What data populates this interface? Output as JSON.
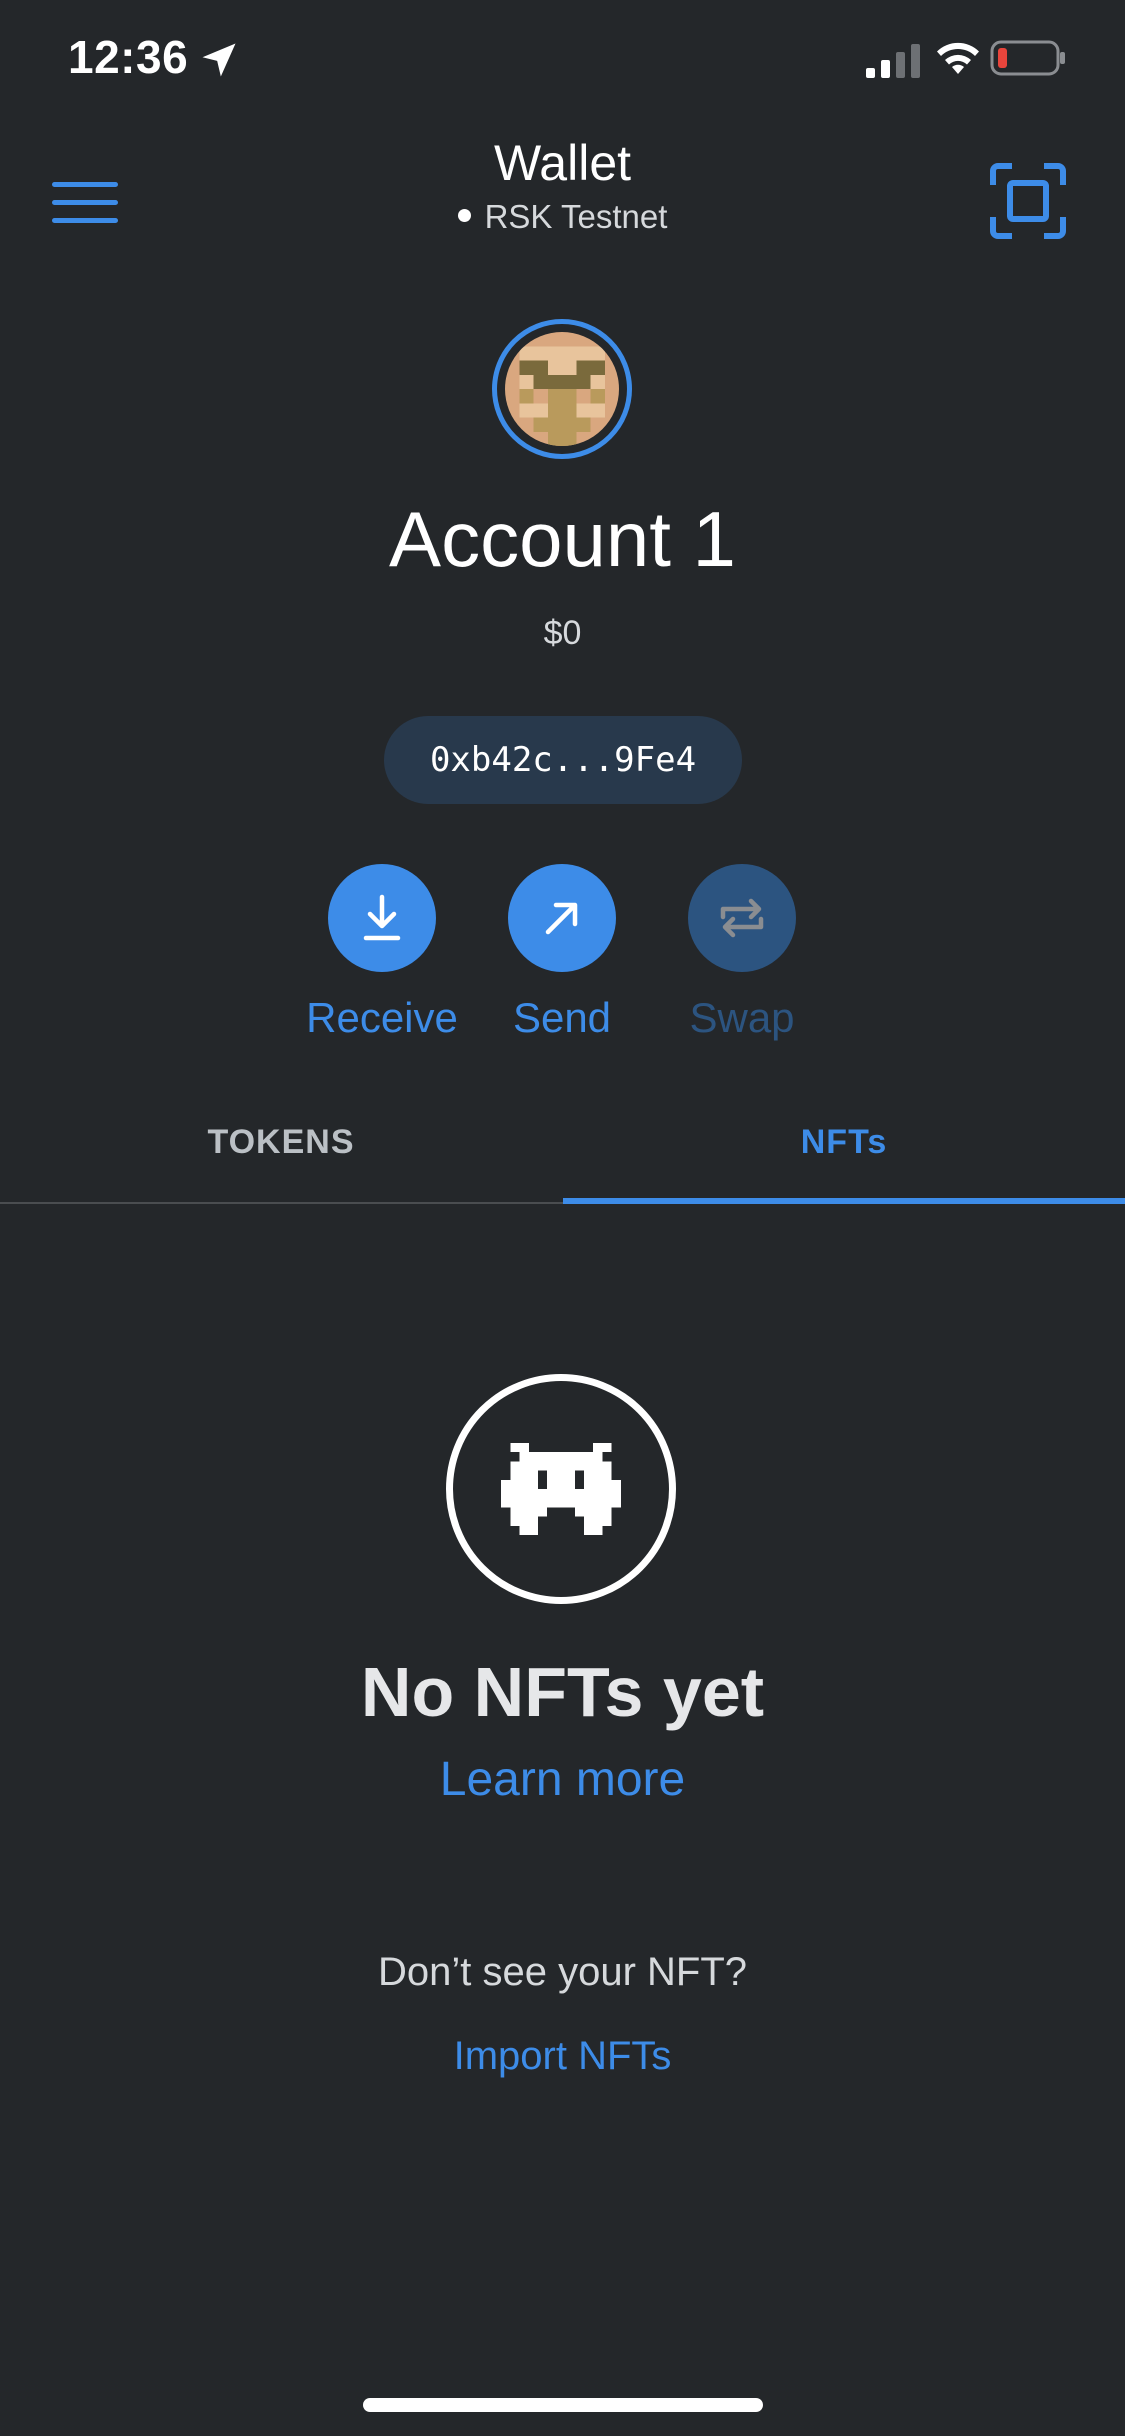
{
  "status_bar": {
    "time": "12:36",
    "icons": [
      "location-arrow-icon",
      "cellular-signal-icon",
      "wifi-icon",
      "battery-low-icon"
    ]
  },
  "header": {
    "title": "Wallet",
    "network": "RSK Testnet",
    "left_icon": "hamburger-menu-icon",
    "right_icon": "qr-scan-icon"
  },
  "account": {
    "name": "Account 1",
    "balance": "$0",
    "address": "0xb42c...9Fe4",
    "avatar_icon": "pixel-identicon-avatar"
  },
  "actions": [
    {
      "label": "Receive",
      "icon": "download-arrow-icon",
      "enabled": true
    },
    {
      "label": "Send",
      "icon": "diagonal-arrow-icon",
      "enabled": true
    },
    {
      "label": "Swap",
      "icon": "swap-arrows-icon",
      "enabled": false
    }
  ],
  "tabs": [
    {
      "label": "TOKENS",
      "active": false
    },
    {
      "label": "NFTs",
      "active": true
    }
  ],
  "empty_state": {
    "icon": "space-invader-icon",
    "title": "No NFTs yet",
    "learn_more": "Learn more",
    "prompt": "Don’t see your NFT?",
    "import_link": "Import NFTs"
  },
  "colors": {
    "background": "#24272a",
    "accent": "#3d8ce8",
    "accent_disabled": "#2c5480",
    "address_pill": "#28394c",
    "battery_low": "#e8453c"
  }
}
